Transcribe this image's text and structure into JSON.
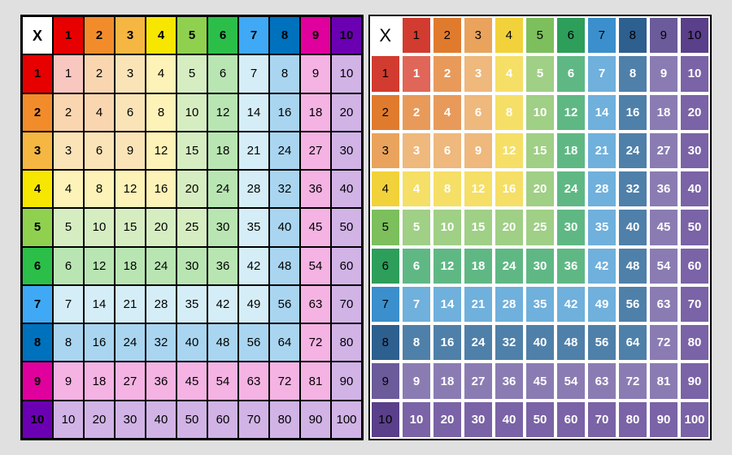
{
  "chart_data": [
    {
      "type": "table",
      "title": "Multiplication chart 1–10 (light style)",
      "corner": "X",
      "row_headers": [
        1,
        2,
        3,
        4,
        5,
        6,
        7,
        8,
        9,
        10
      ],
      "col_headers": [
        1,
        2,
        3,
        4,
        5,
        6,
        7,
        8,
        9,
        10
      ],
      "values": [
        [
          1,
          2,
          3,
          4,
          5,
          6,
          7,
          8,
          9,
          10
        ],
        [
          2,
          4,
          6,
          8,
          10,
          12,
          14,
          16,
          18,
          20
        ],
        [
          3,
          6,
          9,
          12,
          15,
          18,
          21,
          24,
          27,
          30
        ],
        [
          4,
          8,
          12,
          16,
          20,
          24,
          28,
          32,
          36,
          40
        ],
        [
          5,
          10,
          15,
          20,
          25,
          30,
          35,
          40,
          45,
          50
        ],
        [
          6,
          12,
          18,
          24,
          30,
          36,
          42,
          48,
          54,
          60
        ],
        [
          7,
          14,
          21,
          28,
          35,
          42,
          49,
          56,
          63,
          70
        ],
        [
          8,
          16,
          24,
          32,
          40,
          48,
          56,
          64,
          72,
          80
        ],
        [
          9,
          18,
          27,
          36,
          45,
          54,
          63,
          72,
          81,
          90
        ],
        [
          10,
          20,
          30,
          40,
          50,
          60,
          70,
          80,
          90,
          100
        ]
      ],
      "header_colors": [
        "#e60000",
        "#f28c2b",
        "#f5b642",
        "#f7e600",
        "#8fd14f",
        "#2bbf4a",
        "#3fa9f5",
        "#0071bc",
        "#e0009d",
        "#6b00b3"
      ],
      "body_colors": [
        "#f8c7c0",
        "#f9d6b0",
        "#fbe3b8",
        "#fdf3b8",
        "#d6edc2",
        "#b9e5b3",
        "#d5edf6",
        "#a9d5f0",
        "#f4b3e3",
        "#d1b3e6"
      ]
    },
    {
      "type": "table",
      "title": "Multiplication chart 1–10 (dark header style)",
      "corner": "X",
      "row_headers": [
        1,
        2,
        3,
        4,
        5,
        6,
        7,
        8,
        9,
        10
      ],
      "col_headers": [
        1,
        2,
        3,
        4,
        5,
        6,
        7,
        8,
        9,
        10
      ],
      "values": [
        [
          1,
          2,
          3,
          4,
          5,
          6,
          7,
          8,
          9,
          10
        ],
        [
          2,
          4,
          6,
          8,
          10,
          12,
          14,
          16,
          18,
          20
        ],
        [
          3,
          6,
          9,
          12,
          15,
          18,
          21,
          24,
          27,
          30
        ],
        [
          4,
          8,
          12,
          16,
          20,
          24,
          28,
          32,
          36,
          40
        ],
        [
          5,
          10,
          15,
          20,
          25,
          30,
          35,
          40,
          45,
          50
        ],
        [
          6,
          12,
          18,
          24,
          30,
          36,
          42,
          48,
          54,
          60
        ],
        [
          7,
          14,
          21,
          28,
          35,
          42,
          49,
          56,
          63,
          70
        ],
        [
          8,
          16,
          24,
          32,
          40,
          48,
          56,
          64,
          72,
          80
        ],
        [
          9,
          18,
          27,
          36,
          45,
          54,
          63,
          72,
          81,
          90
        ],
        [
          10,
          20,
          30,
          40,
          50,
          60,
          70,
          80,
          90,
          100
        ]
      ],
      "header_colors": [
        "#d23b2f",
        "#e07b2e",
        "#e9a35c",
        "#f2d23a",
        "#7cbf5c",
        "#2e9e5b",
        "#3a8fcc",
        "#2d5f8f",
        "#6b5b9a",
        "#5a3f8a"
      ],
      "body_colors": [
        "#e06659",
        "#e89a5a",
        "#efb87c",
        "#f5df66",
        "#a0cf86",
        "#5fb884",
        "#6fb0dc",
        "#4f80a9",
        "#8a7cb3",
        "#7a63a6"
      ]
    }
  ]
}
